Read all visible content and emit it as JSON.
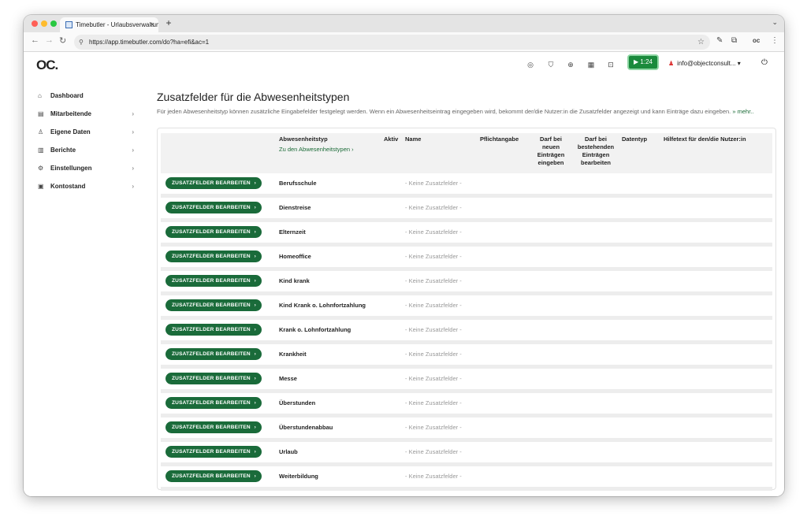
{
  "browser": {
    "tab_title": "Timebutler - Urlaubsverwaltung",
    "url": "https://app.timebutler.com/do?ha=efi&ac=1",
    "new_tab": "+",
    "tab_close": "×"
  },
  "header": {
    "logo": "OC.",
    "timer": "▶ 1:24",
    "user": "info@objectconsult...",
    "user_caret": "▾"
  },
  "sidebar": {
    "items": [
      {
        "label": "Dashboard",
        "icon": "⌂",
        "chevron": ""
      },
      {
        "label": "Mitarbeitende",
        "icon": "▤",
        "chevron": "›"
      },
      {
        "label": "Eigene Daten",
        "icon": "♙",
        "chevron": "›"
      },
      {
        "label": "Berichte",
        "icon": "▥",
        "chevron": "›"
      },
      {
        "label": "Einstellungen",
        "icon": "⚙",
        "chevron": "›"
      },
      {
        "label": "Kontostand",
        "icon": "▣",
        "chevron": "›"
      }
    ]
  },
  "page": {
    "title": "Zusatzfelder für die Abwesenheitstypen",
    "description": "Für jeden Abwesenheitstyp können zusätzliche Eingabefelder festgelegt werden. Wenn ein Abwesenheitseintrag eingegeben wird, bekommt der/die Nutzer:in die Zusatzfelder angezeigt und kann Einträge dazu eingeben.",
    "more": "» mehr.."
  },
  "table": {
    "headers": {
      "type": "Abwesenheitstyp",
      "type_link": "Zu den Abwesenheitstypen ›",
      "active": "Aktiv",
      "name": "Name",
      "required": "Pflichtangabe",
      "new_entries": "Darf bei neuen Einträgen eingeben",
      "edit_entries": "Darf bei bestehenden Einträgen bearbeiten",
      "datatype": "Datentyp",
      "help": "Hilfetext für den/die Nutzer:in"
    },
    "button_label": "ZUSATZFELDER BEARBEITEN",
    "button_chevron": "›",
    "empty_label": "- Keine Zusatzfelder -",
    "rows": [
      "Berufsschule",
      "Dienstreise",
      "Elternzeit",
      "Homeoffice",
      "Kind krank",
      "Kind Krank o. Lohnfortzahlung",
      "Krank o. Lohnfortzahlung",
      "Krankheit",
      "Messe",
      "Überstunden",
      "Überstundenabbau",
      "Urlaub",
      "Weiterbildung"
    ]
  },
  "colors": {
    "brand_green": "#1a6b3a",
    "timer_green": "#1a8a3c"
  }
}
